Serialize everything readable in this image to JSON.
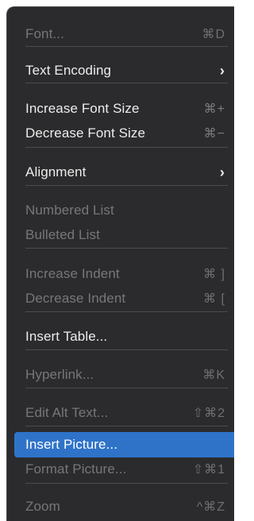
{
  "menu": {
    "items": [
      {
        "label": "Font...",
        "shortcut": "⌘D",
        "enabled": false
      },
      {
        "label": "Text Encoding",
        "submenu": true,
        "enabled": true
      },
      {
        "label": "Increase Font Size",
        "shortcut": "⌘+",
        "enabled": true
      },
      {
        "label": "Decrease Font Size",
        "shortcut": "⌘−",
        "enabled": true
      },
      {
        "label": "Alignment",
        "submenu": true,
        "enabled": true
      },
      {
        "label": "Numbered List",
        "enabled": false
      },
      {
        "label": "Bulleted List",
        "enabled": false
      },
      {
        "label": "Increase Indent",
        "shortcut": "⌘ ]",
        "enabled": false
      },
      {
        "label": "Decrease Indent",
        "shortcut": "⌘ [",
        "enabled": false
      },
      {
        "label": "Insert Table...",
        "enabled": true
      },
      {
        "label": "Hyperlink...",
        "shortcut": "⌘K",
        "enabled": false
      },
      {
        "label": "Edit Alt Text...",
        "shortcut": "⇧⌘2",
        "enabled": false
      },
      {
        "label": "Insert Picture...",
        "enabled": true,
        "highlighted": true
      },
      {
        "label": "Format Picture...",
        "shortcut": "⇧⌘1",
        "enabled": false
      },
      {
        "label": "Zoom",
        "shortcut": "^⌘Z",
        "enabled": false
      }
    ],
    "colors": {
      "background": "#2b2b2d",
      "highlight": "#2f73c9",
      "enabled_text": "#ececec",
      "disabled_text": "#77777b"
    }
  }
}
